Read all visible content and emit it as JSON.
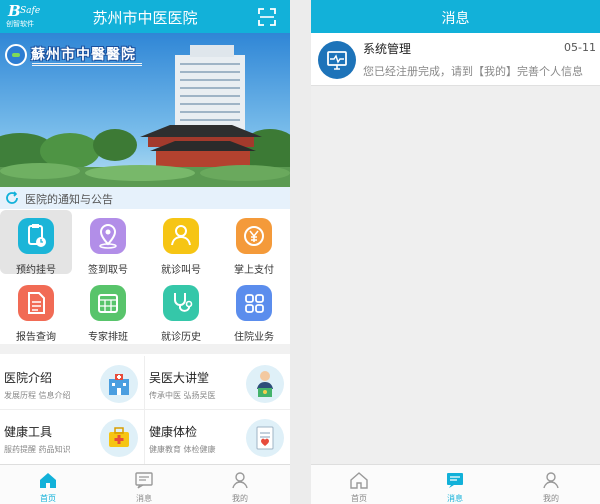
{
  "left": {
    "header": {
      "logo_mark": "B",
      "logo_word": "Safe",
      "logo_cn": "创智软件",
      "title": "苏州市中医医院"
    },
    "banner": {
      "hospital_name": "蘇州市中醫醫院"
    },
    "notice": {
      "label": "医院的通知与公告"
    },
    "grid": [
      {
        "label": "预约挂号",
        "color": "#1bb5d8",
        "icon": "clipboard-clock-icon"
      },
      {
        "label": "签到取号",
        "color": "#b28ee8",
        "icon": "location-pin-icon"
      },
      {
        "label": "就诊叫号",
        "color": "#f6c514",
        "icon": "person-speaker-icon"
      },
      {
        "label": "掌上支付",
        "color": "#f49a3a",
        "icon": "yen-coin-icon"
      },
      {
        "label": "报告查询",
        "color": "#f16b55",
        "icon": "document-icon"
      },
      {
        "label": "专家排班",
        "color": "#58c46b",
        "icon": "calendar-grid-icon"
      },
      {
        "label": "就诊历史",
        "color": "#35c7a9",
        "icon": "stethoscope-icon"
      },
      {
        "label": "住院业务",
        "color": "#5b8ded",
        "icon": "apps-grid-icon"
      }
    ],
    "cards": [
      {
        "title": "医院介绍",
        "subtitle": "发展历程 信息介绍",
        "icon": "hospital-building-icon"
      },
      {
        "title": "吴医大讲堂",
        "subtitle": "传承中医 弘扬吴医",
        "icon": "doctor-podium-icon"
      },
      {
        "title": "健康工具",
        "subtitle": "服药提醒 药品知识",
        "icon": "medical-kit-icon"
      },
      {
        "title": "健康体检",
        "subtitle": "健康教育 体检健康",
        "icon": "health-report-icon"
      }
    ],
    "tabs": [
      {
        "label": "首页",
        "icon": "home-icon",
        "active": true
      },
      {
        "label": "消息",
        "icon": "message-icon",
        "active": false
      },
      {
        "label": "我的",
        "icon": "user-icon",
        "active": false
      }
    ]
  },
  "right": {
    "header": {
      "title": "消息"
    },
    "messages": [
      {
        "title": "系统管理",
        "time": "05-11",
        "text": "您已经注册完成，请到【我的】完善个人信息",
        "icon": "monitor-icon"
      }
    ],
    "tabs": [
      {
        "label": "首页",
        "icon": "home-icon",
        "active": false
      },
      {
        "label": "消息",
        "icon": "message-icon",
        "active": true
      },
      {
        "label": "我的",
        "icon": "user-icon",
        "active": false
      }
    ]
  },
  "colors": {
    "accent": "#12b1d9"
  }
}
